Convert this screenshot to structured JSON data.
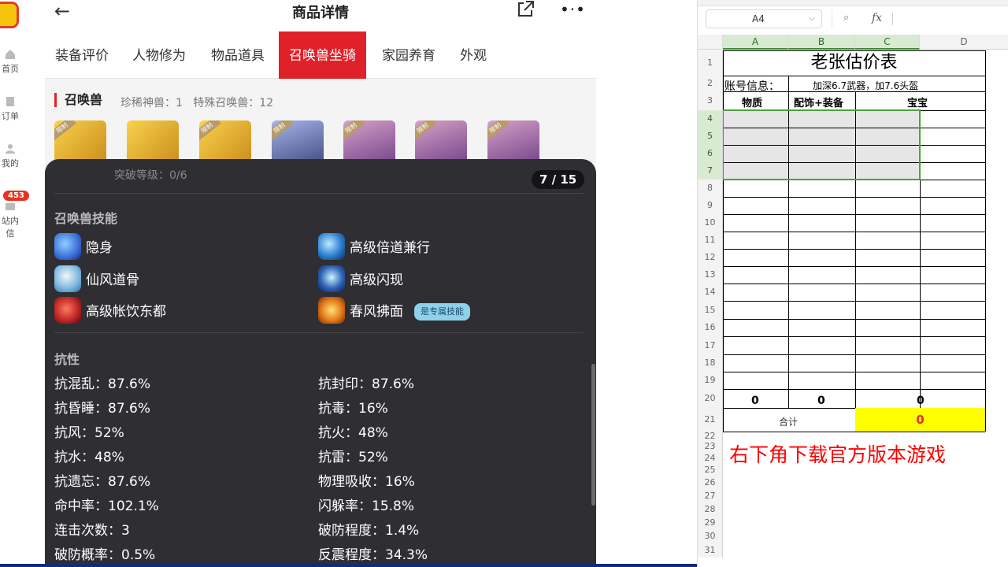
{
  "sidebar": {
    "items": [
      {
        "label": "首页",
        "icon": "home-icon"
      },
      {
        "label": "订单",
        "icon": "order-icon"
      },
      {
        "label": "我的",
        "icon": "user-icon"
      },
      {
        "label": "站内信",
        "icon": "message-icon"
      }
    ],
    "badge": "453"
  },
  "phone": {
    "title": "商品详情",
    "tabs": [
      "装备评价",
      "人物修为",
      "物品道具",
      "召唤兽坐骑",
      "家园养育",
      "外观"
    ],
    "active_tab": "召唤兽坐骑",
    "section": {
      "title": "召唤兽",
      "rare": "珍稀神兽：1",
      "special": "特殊召唤兽：12"
    },
    "thumb_tag": "限制"
  },
  "overlay": {
    "breakthrough": "突破等级：0/6",
    "counter": "7 / 15",
    "skills_title": "召唤兽技能",
    "skills": [
      {
        "name": "隐身",
        "icon": "stealth-skill-icon",
        "color": "#3b6fd8"
      },
      {
        "name": "高级倍道兼行",
        "icon": "speed-skill-icon",
        "color": "#2c7fd0"
      },
      {
        "name": "仙风道骨",
        "icon": "immortal-skill-icon",
        "color": "#78b4e0"
      },
      {
        "name": "高级闪现",
        "icon": "flash-skill-icon",
        "color": "#2f63b8"
      },
      {
        "name": "高级帐饮东都",
        "icon": "feast-skill-icon",
        "color": "#c02828"
      },
      {
        "name": "春风拂面",
        "icon": "breeze-skill-icon",
        "color": "#e57a1a",
        "badge": "是专属技能"
      }
    ],
    "resist_title": "抗性",
    "resistances": [
      "抗混乱：87.6%",
      "抗封印：87.6%",
      "抗昏睡：87.6%",
      "抗毒：16%",
      "抗风：52%",
      "抗火：48%",
      "抗水：48%",
      "抗雷：52%",
      "抗遗忘：87.6%",
      "物理吸收：16%",
      "命中率：102.1%",
      "闪躲率：15.8%",
      "连击次数：3",
      "破防程度：1.4%",
      "破防概率：0.5%",
      "反震程度：34.3%"
    ]
  },
  "sheet": {
    "name_box": "A4",
    "fx_label": "fx",
    "columns": [
      "A",
      "B",
      "C",
      "D"
    ],
    "rows": [
      "1",
      "2",
      "3",
      "4",
      "5",
      "6",
      "7",
      "8",
      "9",
      "10",
      "11",
      "12",
      "13",
      "14",
      "15",
      "16",
      "17",
      "18",
      "19",
      "20",
      "21",
      "22",
      "23",
      "24",
      "25",
      "26",
      "27",
      "28",
      "29",
      "30",
      "31"
    ],
    "title": "老张估价表",
    "account_label": "账号信息：",
    "account_info": "加深6.7武器，加7.6头盔",
    "headers": [
      "物质",
      "配饰+装备",
      "宝宝"
    ],
    "sums": [
      "0",
      "0",
      "0"
    ],
    "total_label": "合计",
    "total_value": "0",
    "note": "右下角下载官方版本游戏",
    "colors": {
      "selection": "#4aa33d",
      "total_bg": "#ffff00",
      "note": "#ff0000"
    }
  }
}
